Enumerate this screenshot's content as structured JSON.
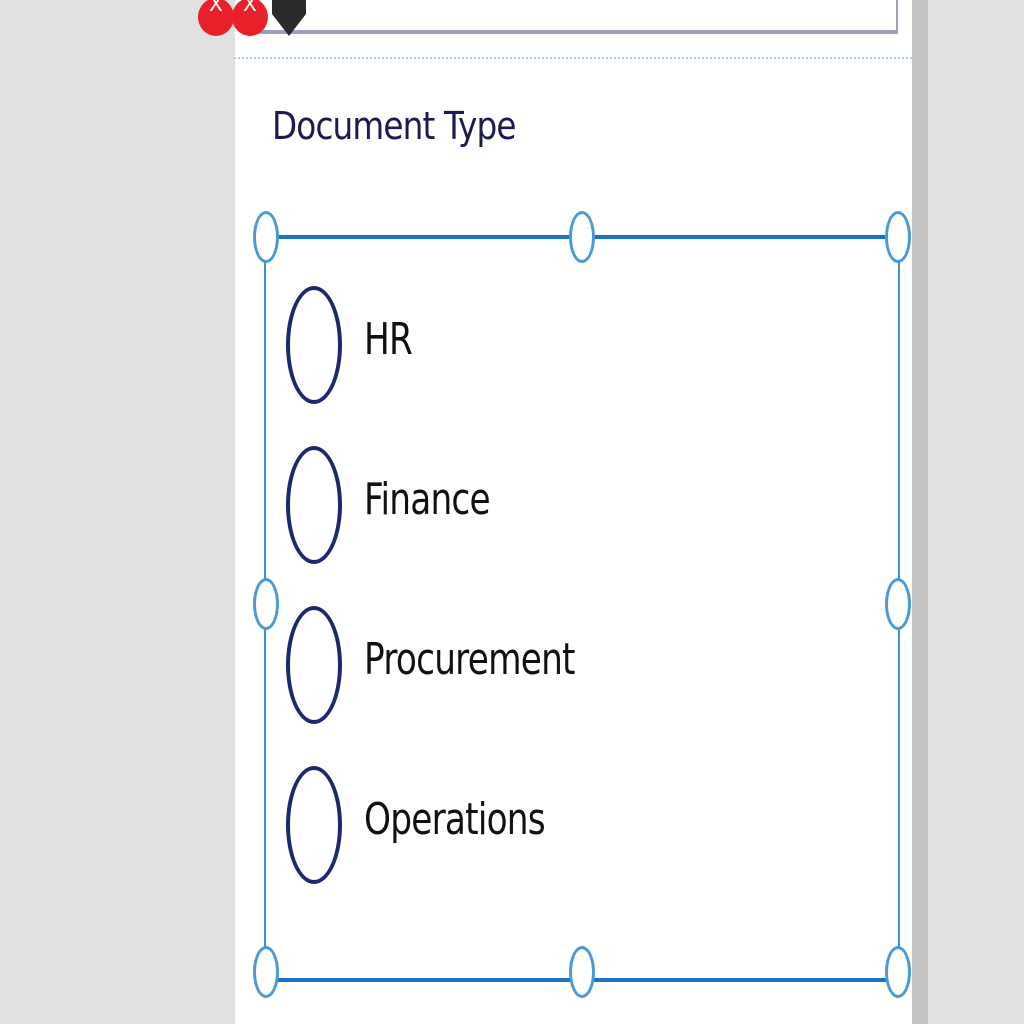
{
  "field": {
    "label": "Document Type"
  },
  "radio_group": {
    "options": [
      {
        "label": "HR",
        "selected": false
      },
      {
        "label": "Finance",
        "selected": false
      },
      {
        "label": "Procurement",
        "selected": false
      },
      {
        "label": "Operations",
        "selected": false
      }
    ]
  },
  "top_icons": {
    "error_glyph": "X",
    "error_color": "#e8202a",
    "warning_color": "#2b2b2b",
    "icons": [
      "error-icon",
      "error-icon",
      "warning-icon"
    ]
  },
  "colors": {
    "selection": "#1a74c2",
    "radio_border": "#1b2a6e",
    "label_text": "#1d1a4f"
  }
}
